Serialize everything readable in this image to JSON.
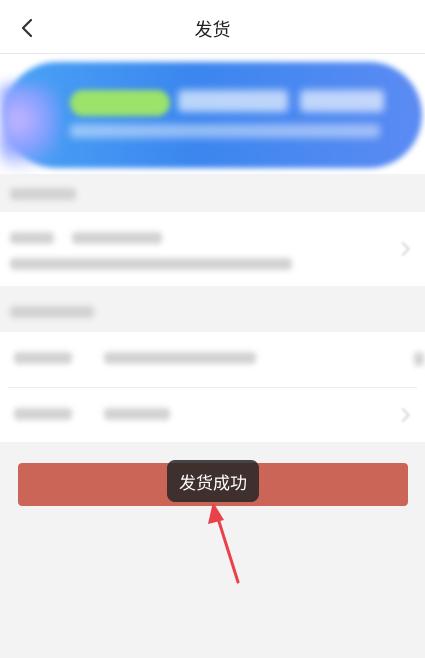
{
  "navbar": {
    "title": "发货",
    "back_icon": "chevron-left-icon"
  },
  "toast": {
    "text": "发货成功"
  },
  "annotation": {
    "arrow_color": "#e8414a"
  },
  "colors": {
    "submit_button": "#cb6558",
    "page_background": "#f3f3f3",
    "banner_blue": "#3b86ef"
  }
}
